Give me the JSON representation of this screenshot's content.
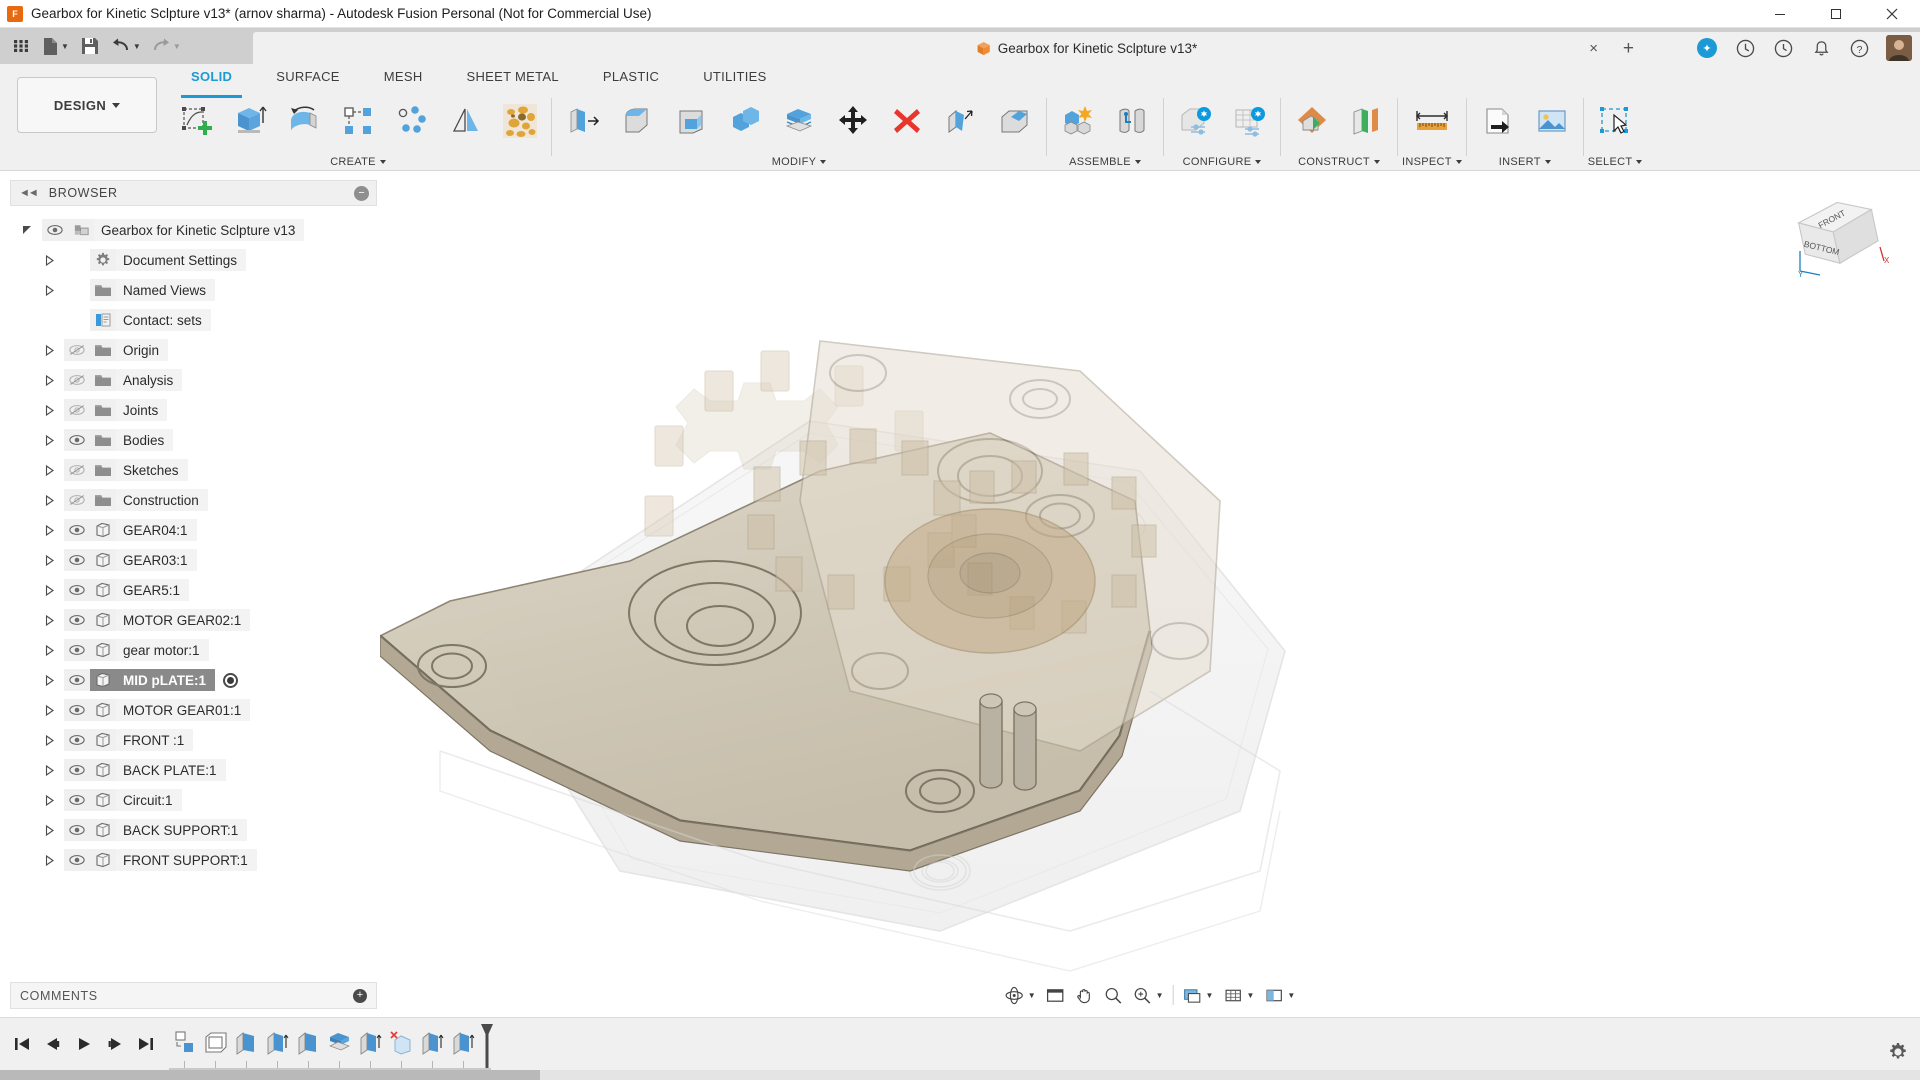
{
  "window": {
    "title": "Gearbox for Kinetic Sclpture v13* (arnov sharma) - Autodesk Fusion Personal (Not for Commercial Use)",
    "app_icon": "fusion-logo-icon",
    "controls": [
      {
        "name": "minimize-button",
        "glyph": "minimize-icon"
      },
      {
        "name": "maximize-button",
        "glyph": "maximize-icon"
      },
      {
        "name": "close-button",
        "glyph": "close-icon"
      }
    ]
  },
  "quick_access": {
    "items": [
      {
        "name": "app-grid-button",
        "icon": "grid-menu-icon",
        "caret": false
      },
      {
        "name": "new-file-button",
        "icon": "file-icon",
        "caret": true
      },
      {
        "name": "save-button",
        "icon": "save-disk-icon",
        "caret": false
      },
      {
        "name": "undo-button",
        "icon": "undo-arrow-icon",
        "caret": true
      },
      {
        "name": "redo-button",
        "icon": "redo-arrow-icon",
        "caret": true,
        "disabled": true
      }
    ]
  },
  "document_tab": {
    "icon": "orange-cube-icon",
    "title": "Gearbox for Kinetic Sclpture v13*",
    "close_label": "×",
    "new_tab_label": "+",
    "right_icons": [
      {
        "name": "extensions-icon",
        "glyph": "✦"
      },
      {
        "name": "help-clock-icon",
        "glyph": "?"
      },
      {
        "name": "recent-activity-icon",
        "glyph": "◴"
      },
      {
        "name": "notifications-bell-icon",
        "glyph": "ὑ4"
      },
      {
        "name": "help-question-icon",
        "glyph": "?"
      },
      {
        "name": "user-avatar",
        "glyph": ""
      }
    ]
  },
  "ribbon": {
    "workspace_selector": {
      "label": "DESIGN",
      "name": "workspace-design-dropdown"
    },
    "tabs": [
      {
        "label": "SOLID",
        "active": true
      },
      {
        "label": "SURFACE",
        "active": false
      },
      {
        "label": "MESH",
        "active": false
      },
      {
        "label": "SHEET METAL",
        "active": false
      },
      {
        "label": "PLASTIC",
        "active": false
      },
      {
        "label": "UTILITIES",
        "active": false
      }
    ],
    "panels": [
      {
        "label": "CREATE",
        "has_caret": true,
        "tools": [
          {
            "name": "create-sketch-tool",
            "icon": "sketch-plus-icon"
          },
          {
            "name": "extrude-tool",
            "icon": "extrude-icon"
          },
          {
            "name": "revolve-tool",
            "icon": "revolve-icon"
          },
          {
            "name": "rectangular-pattern-tool",
            "icon": "rect-pattern-icon"
          },
          {
            "name": "circular-pattern-tool",
            "icon": "circular-pattern-icon"
          },
          {
            "name": "mirror-tool",
            "icon": "mirror-icon"
          },
          {
            "name": "volumetric-lattice-tool",
            "icon": "lattice-texture-icon"
          }
        ]
      },
      {
        "label": "MODIFY",
        "has_caret": true,
        "tools": [
          {
            "name": "press-pull-tool",
            "icon": "press-pull-icon"
          },
          {
            "name": "fillet-tool",
            "icon": "fillet-icon"
          },
          {
            "name": "shell-tool",
            "icon": "shell-icon"
          },
          {
            "name": "combine-tool",
            "icon": "combine-icon"
          },
          {
            "name": "offset-face-tool",
            "icon": "offset-face-icon"
          },
          {
            "name": "move-copy-tool",
            "icon": "move-copy-arrows-icon"
          },
          {
            "name": "delete-tool",
            "icon": "red-x-delete-icon"
          },
          {
            "name": "draft-tool",
            "icon": "draft-icon"
          },
          {
            "name": "align-tool",
            "icon": "align-icon"
          }
        ]
      },
      {
        "label": "ASSEMBLE",
        "has_caret": true,
        "tools": [
          {
            "name": "new-component-tool",
            "icon": "new-component-star-icon"
          },
          {
            "name": "joint-tool",
            "icon": "joint-icon"
          }
        ]
      },
      {
        "label": "CONFIGURE",
        "has_caret": true,
        "tools": [
          {
            "name": "configure-design-tool",
            "icon": "configure-part-icon"
          },
          {
            "name": "configuration-table-tool",
            "icon": "configure-table-icon"
          }
        ]
      },
      {
        "label": "CONSTRUCT",
        "has_caret": true,
        "tools": [
          {
            "name": "offset-plane-tool",
            "icon": "offset-plane-icon"
          },
          {
            "name": "plane-along-path-tool",
            "icon": "planes-stack-icon"
          }
        ]
      },
      {
        "label": "INSPECT",
        "has_caret": true,
        "tools": [
          {
            "name": "measure-tool",
            "icon": "ruler-measure-icon"
          }
        ]
      },
      {
        "label": "INSERT",
        "has_caret": true,
        "tools": [
          {
            "name": "insert-derive-tool",
            "icon": "insert-derive-icon"
          },
          {
            "name": "insert-canvas-tool",
            "icon": "insert-image-icon"
          }
        ]
      },
      {
        "label": "SELECT",
        "has_caret": true,
        "tools": [
          {
            "name": "select-tool",
            "icon": "select-cursor-icon"
          }
        ]
      }
    ]
  },
  "browser": {
    "header": {
      "collapse_icon": "double-left-arrows-icon",
      "title": "BROWSER",
      "minimize_icon": "minus-circle-icon"
    },
    "tree": [
      {
        "label": "Gearbox for Kinetic Sclpture v13",
        "indent": 0,
        "twisty": "open",
        "eye": "visible",
        "icon": "document-root-icon",
        "selected": false
      },
      {
        "label": "Document Settings",
        "indent": 1,
        "twisty": "closed",
        "eye": "none",
        "icon": "gear-icon",
        "selected": false
      },
      {
        "label": "Named Views",
        "indent": 1,
        "twisty": "closed",
        "eye": "none",
        "icon": "folder-icon",
        "selected": false
      },
      {
        "label": "Contact: sets",
        "indent": 1,
        "twisty": "none",
        "eye": "none",
        "icon": "contact-sets-icon",
        "selected": false
      },
      {
        "label": "Origin",
        "indent": 1,
        "twisty": "closed",
        "eye": "hidden",
        "icon": "folder-icon",
        "selected": false
      },
      {
        "label": "Analysis",
        "indent": 1,
        "twisty": "closed",
        "eye": "hidden",
        "icon": "folder-icon",
        "selected": false
      },
      {
        "label": "Joints",
        "indent": 1,
        "twisty": "closed",
        "eye": "hidden",
        "icon": "folder-icon",
        "selected": false
      },
      {
        "label": "Bodies",
        "indent": 1,
        "twisty": "closed",
        "eye": "visible",
        "icon": "folder-icon",
        "selected": false
      },
      {
        "label": "Sketches",
        "indent": 1,
        "twisty": "closed",
        "eye": "hidden",
        "icon": "folder-icon",
        "selected": false
      },
      {
        "label": "Construction",
        "indent": 1,
        "twisty": "closed",
        "eye": "hidden",
        "icon": "folder-icon",
        "selected": false
      },
      {
        "label": "GEAR04:1",
        "indent": 1,
        "twisty": "closed",
        "eye": "visible",
        "icon": "component-icon",
        "selected": false
      },
      {
        "label": "GEAR03:1",
        "indent": 1,
        "twisty": "closed",
        "eye": "visible",
        "icon": "component-icon",
        "selected": false
      },
      {
        "label": "GEAR5:1",
        "indent": 1,
        "twisty": "closed",
        "eye": "visible",
        "icon": "component-icon",
        "selected": false
      },
      {
        "label": "MOTOR GEAR02:1",
        "indent": 1,
        "twisty": "closed",
        "eye": "visible",
        "icon": "component-icon",
        "selected": false
      },
      {
        "label": "gear motor:1",
        "indent": 1,
        "twisty": "closed",
        "eye": "visible",
        "icon": "component-icon",
        "selected": false
      },
      {
        "label": "MID pLATE:1",
        "indent": 1,
        "twisty": "closed",
        "eye": "visible",
        "icon": "component-icon",
        "selected": true
      },
      {
        "label": "MOTOR GEAR01:1",
        "indent": 1,
        "twisty": "closed",
        "eye": "visible",
        "icon": "component-icon",
        "selected": false
      },
      {
        "label": "FRONT :1",
        "indent": 1,
        "twisty": "closed",
        "eye": "visible",
        "icon": "component-icon",
        "selected": false
      },
      {
        "label": "BACK PLATE:1",
        "indent": 1,
        "twisty": "closed",
        "eye": "visible",
        "icon": "component-icon",
        "selected": false
      },
      {
        "label": "Circuit:1",
        "indent": 1,
        "twisty": "closed",
        "eye": "visible",
        "icon": "component-icon",
        "selected": false
      },
      {
        "label": "BACK SUPPORT:1",
        "indent": 1,
        "twisty": "closed",
        "eye": "visible",
        "icon": "component-icon",
        "selected": false
      },
      {
        "label": "FRONT SUPPORT:1",
        "indent": 1,
        "twisty": "closed",
        "eye": "visible",
        "icon": "component-icon",
        "selected": false
      }
    ]
  },
  "comments": {
    "title": "COMMENTS",
    "add_icon": "add-comment-icon"
  },
  "viewcube": {
    "top_face": "FRONT",
    "front_face": "BOTTOM",
    "axis_x": "X",
    "axis_y": "Y"
  },
  "navbar": {
    "items": [
      {
        "name": "orbit-tool",
        "icon": "orbit-icon",
        "caret": true
      },
      {
        "name": "pan-zoom-fit-tool",
        "icon": "fit-window-icon",
        "caret": false
      },
      {
        "name": "pan-tool",
        "icon": "hand-pan-icon",
        "caret": false
      },
      {
        "name": "zoom-tool",
        "icon": "magnifier-icon",
        "caret": false
      },
      {
        "name": "zoom-window-tool",
        "icon": "magnifier-window-icon",
        "caret": true
      },
      {
        "name": "display-settings",
        "icon": "display-settings-icon",
        "caret": true
      },
      {
        "name": "grid-snaps",
        "icon": "grid-snaps-icon",
        "caret": true
      },
      {
        "name": "viewports",
        "icon": "viewports-icon",
        "caret": true
      }
    ]
  },
  "timeline": {
    "playback": [
      {
        "name": "timeline-go-start",
        "icon": "skip-start-icon"
      },
      {
        "name": "timeline-step-back",
        "icon": "step-back-icon"
      },
      {
        "name": "timeline-play",
        "icon": "play-icon"
      },
      {
        "name": "timeline-step-forward",
        "icon": "step-forward-icon"
      },
      {
        "name": "timeline-go-end",
        "icon": "skip-end-icon"
      }
    ],
    "features": [
      {
        "name": "timeline-feature-1",
        "icon": "move-copy-feature-icon"
      },
      {
        "name": "timeline-feature-2",
        "icon": "sketch-feature-icon"
      },
      {
        "name": "timeline-feature-3",
        "icon": "extrude-feature-icon"
      },
      {
        "name": "timeline-feature-4",
        "icon": "extrude-up-feature-icon"
      },
      {
        "name": "timeline-feature-5",
        "icon": "extrude-feature-icon"
      },
      {
        "name": "timeline-feature-6",
        "icon": "offset-feature-icon"
      },
      {
        "name": "timeline-feature-7",
        "icon": "extrude-up-feature-icon"
      },
      {
        "name": "timeline-feature-8",
        "icon": "delete-feature-icon"
      },
      {
        "name": "timeline-feature-9",
        "icon": "extrude-up-feature-icon"
      },
      {
        "name": "timeline-feature-10",
        "icon": "extrude-up-feature-icon"
      }
    ],
    "marker": "timeline-end-marker",
    "settings_icon": "settings-gear-icon"
  },
  "colors": {
    "accent": "#1b9ad6",
    "selection": "#8a8a8a",
    "ribbon_bg": "#f0f0f0",
    "qat_bg": "#cfcfcf",
    "delete_red": "#e8352d",
    "orange": "#e86a10",
    "model_tan": "#cfc6b4"
  }
}
